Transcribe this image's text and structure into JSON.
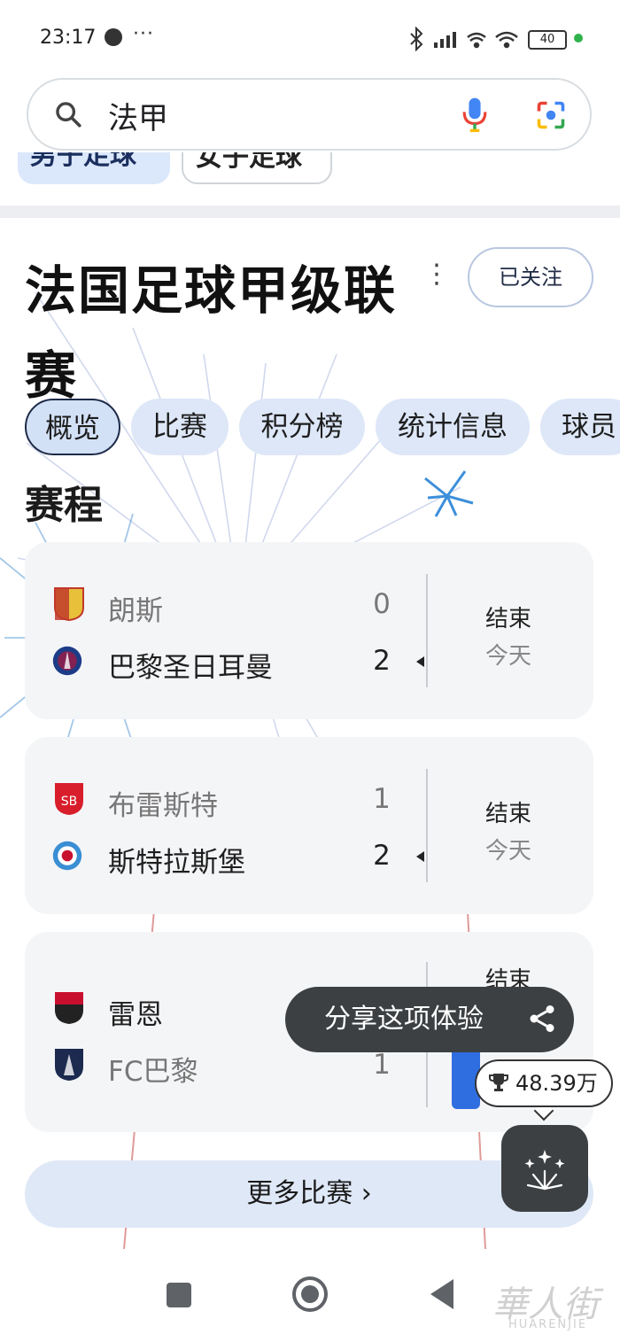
{
  "status_bar": {
    "time": "23:17",
    "dots": "···",
    "battery": "40"
  },
  "search": {
    "query": "法甲"
  },
  "filter_chips": [
    {
      "label": "男子足球"
    },
    {
      "label": "女子足球"
    }
  ],
  "league": {
    "title": "法国足球甲级联赛",
    "follow_label": "已关注"
  },
  "tabs": [
    {
      "label": "概览"
    },
    {
      "label": "比赛"
    },
    {
      "label": "积分榜"
    },
    {
      "label": "统计信息"
    },
    {
      "label": "球员"
    }
  ],
  "schedule": {
    "title": "赛程",
    "matches": [
      {
        "home": "朗斯",
        "home_score": "0",
        "away": "巴黎圣日耳曼",
        "away_score": "2",
        "status": "结束",
        "date": "今天"
      },
      {
        "home": "布雷斯特",
        "home_score": "1",
        "away": "斯特拉斯堡",
        "away_score": "2",
        "status": "结束",
        "date": "今天"
      },
      {
        "home": "雷恩",
        "home_score": "",
        "away": "FC巴黎",
        "away_score": "1",
        "status": "结束",
        "date": ""
      }
    ],
    "more_label": "更多比赛 ›"
  },
  "overlay": {
    "share_label": "分享这项体验",
    "counter": "48.39万"
  },
  "watermark": {
    "text": "華人街",
    "sub": "HUARENJIE"
  },
  "colors": {
    "accent": "#1a73e8",
    "chip_bg": "#dde7f8",
    "overlay_bg": "#3c4043"
  }
}
